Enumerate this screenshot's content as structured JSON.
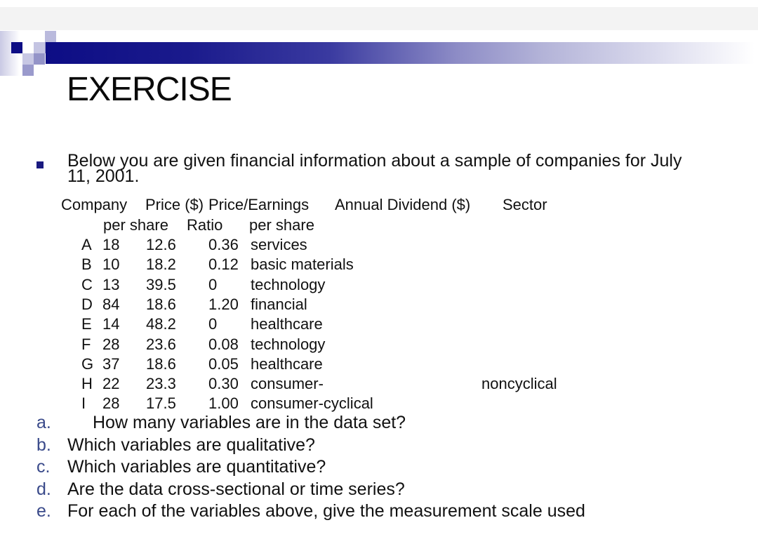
{
  "slide": {
    "title": "EXERCISE",
    "accent_color": "#1a1a80",
    "marker_color": "#3a4a8a",
    "intro_line1": "Below you are given financial information about a sample of companies for July",
    "intro_line2": "11, 2001."
  },
  "table": {
    "headers_line1": {
      "company": "Company",
      "price": "Price ($)",
      "pe": "Price/Earnings",
      "dividend": "Annual Dividend ($)",
      "sector": "Sector"
    },
    "headers_line2": {
      "price": "per share",
      "pe": "Ratio",
      "dividend": "per share"
    },
    "rows": [
      {
        "company": "A",
        "price": "18",
        "pe": "12.6",
        "dividend": "0.36",
        "sector": "services"
      },
      {
        "company": "B",
        "price": "10",
        "pe": "18.2",
        "dividend": "0.12",
        "sector": "basic materials"
      },
      {
        "company": "C",
        "price": "13",
        "pe": "39.5",
        "dividend": "0",
        "sector": "technology"
      },
      {
        "company": "D",
        "price": "84",
        "pe": "18.6",
        "dividend": "1.20",
        "sector": "financial"
      },
      {
        "company": "E",
        "price": "14",
        "pe": "48.2",
        "dividend": "0",
        "sector": "healthcare"
      },
      {
        "company": "F",
        "price": "28",
        "pe": "23.6",
        "dividend": "0.08",
        "sector": "technology"
      },
      {
        "company": "G",
        "price": "37",
        "pe": "18.6",
        "dividend": "0.05",
        "sector": "healthcare"
      },
      {
        "company": "H",
        "price": "22",
        "pe": "23.3",
        "dividend": "0.30",
        "sector": "consumer-",
        "sector_overflow": "noncyclical"
      },
      {
        "company": "I",
        "price": "28",
        "pe": "17.5",
        "dividend": "1.00",
        "sector": "consumer-cyclical"
      }
    ]
  },
  "questions": [
    {
      "marker": "a.",
      "text": "How many variables are in the data set?"
    },
    {
      "marker": "b.",
      "text": "Which variables are qualitative?"
    },
    {
      "marker": "c.",
      "text": "Which variables are quantitative?"
    },
    {
      "marker": "d.",
      "text": "Are the data cross-sectional or time series?"
    },
    {
      "marker": "e.",
      "text": "For each of the variables above, give the measurement scale used"
    }
  ]
}
